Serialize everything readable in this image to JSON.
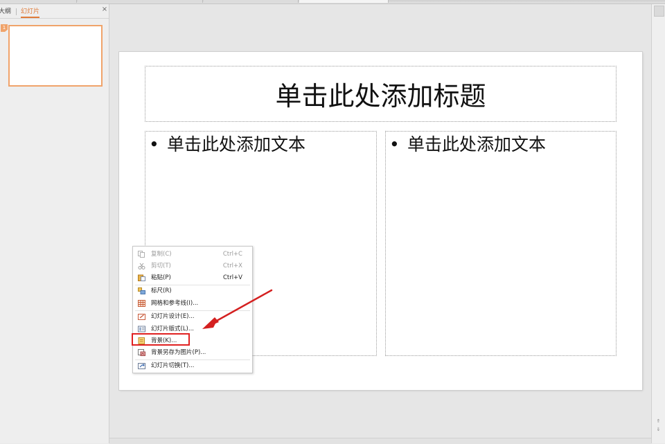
{
  "left_panel": {
    "tab_outline": "大纲",
    "tab_slides": "幻灯片",
    "close_glyph": "×",
    "thumb_number": "1"
  },
  "slide": {
    "title_placeholder": "单击此处添加标题",
    "left_body_placeholder": "单击此处添加文本",
    "right_body_placeholder": "单击此处添加文本",
    "bullet": "•"
  },
  "context_menu": {
    "items": [
      {
        "label": "复制(C)",
        "shortcut": "Ctrl+C",
        "icon": "copy-icon",
        "enabled": false
      },
      {
        "label": "剪切(T)",
        "shortcut": "Ctrl+X",
        "icon": "cut-icon",
        "enabled": false
      },
      {
        "label": "粘贴(P)",
        "shortcut": "Ctrl+V",
        "icon": "paste-icon",
        "enabled": true
      },
      {
        "label": "标尺(R)",
        "shortcut": "",
        "icon": "ruler-icon",
        "enabled": true
      },
      {
        "label": "网格和参考线(I)...",
        "shortcut": "",
        "icon": "grid-icon",
        "enabled": true
      },
      {
        "label": "幻灯片设计(E)...",
        "shortcut": "",
        "icon": "slide-design-icon",
        "enabled": true
      },
      {
        "label": "幻灯片版式(L)...",
        "shortcut": "",
        "icon": "slide-layout-icon",
        "enabled": true
      },
      {
        "label": "背景(K)...",
        "shortcut": "",
        "icon": "background-icon",
        "enabled": true
      },
      {
        "label": "背景另存为图片(P)...",
        "shortcut": "",
        "icon": "save-background-icon",
        "enabled": true
      },
      {
        "label": "幻灯片切换(T)...",
        "shortcut": "",
        "icon": "slide-transition-icon",
        "enabled": true
      }
    ]
  },
  "colors": {
    "accent_orange": "#e07b39",
    "highlight_red": "#e02020"
  }
}
